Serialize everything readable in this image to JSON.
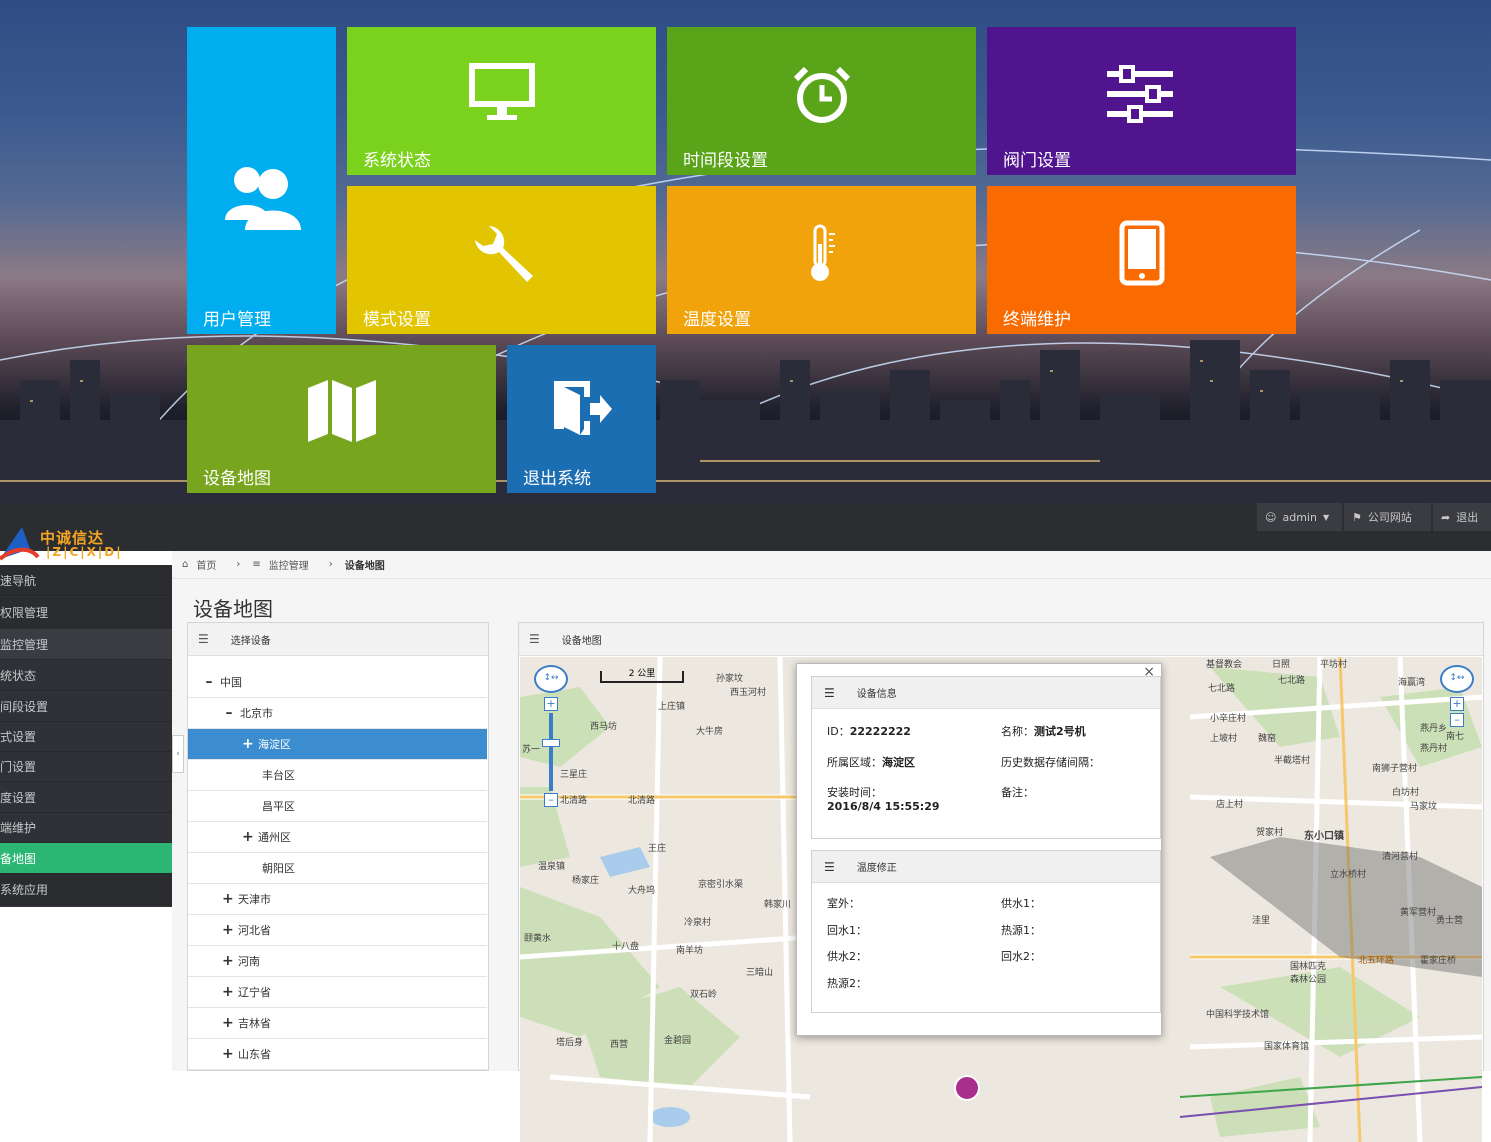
{
  "tiles": {
    "user": {
      "label": "用户管理",
      "color": "#00adef"
    },
    "status": {
      "label": "系统状态",
      "color": "#7bd21d"
    },
    "time": {
      "label": "时间段设置",
      "color": "#5aa41a"
    },
    "valve": {
      "label": "阀门设置",
      "color": "#51148f"
    },
    "mode": {
      "label": "模式设置",
      "color": "#e2c500"
    },
    "temp": {
      "label": "温度设置",
      "color": "#f0a30a"
    },
    "terminal": {
      "label": "终端维护",
      "color": "#f96a00"
    },
    "map": {
      "label": "设备地图",
      "color": "#78a51e"
    },
    "logout": {
      "label": "退出系统",
      "color": "#1b6eb2"
    }
  },
  "logo": {
    "cn": "中诚信达",
    "en": "|Z|C|X|D|"
  },
  "topbar": {
    "user": "admin",
    "site": "公司网站",
    "exit": "退出"
  },
  "sidebar": [
    "速导航",
    "权限管理",
    "监控管理",
    "统状态",
    "间段设置",
    "式设置",
    "门设置",
    "度设置",
    "端维护",
    "备地图",
    "系统应用"
  ],
  "breadcrumb": {
    "home": "首页",
    "section": "监控管理",
    "current": "设备地图"
  },
  "page_title": "设备地图",
  "tree": {
    "header": "选择设备",
    "rows": [
      "中国",
      "北京市",
      "海淀区",
      "丰台区",
      "昌平区",
      "通州区",
      "朝阳区",
      "天津市",
      "河北省",
      "河南",
      "辽宁省",
      "吉林省",
      "山东省"
    ]
  },
  "mappanel": {
    "header": "设备地图",
    "scale": "2 公里",
    "labels": [
      "上庄镇",
      "西马坊",
      "大牛房",
      "苏一",
      "三星庄",
      "北清路",
      "北清路",
      "王庄",
      "温泉镇",
      "杨家庄",
      "大舟坞",
      "京密引水渠",
      "韩家川",
      "冷泉村",
      "颐黄水",
      "十八盘",
      "南羊坊",
      "三暗山",
      "双石岭",
      "塔后身",
      "西营",
      "金碧园",
      "孙家坟",
      "西玉河村",
      "七北路",
      "七北路",
      "小辛庄村",
      "上坡村",
      "魏窑",
      "平坊村",
      "半截塔村",
      "燕丹乡",
      "燕丹村",
      "南狮子营村",
      "白坊村",
      "马家坟",
      "店上村",
      "贺家村",
      "东小口镇",
      "清河营村",
      "立水桥村",
      "黄军营村",
      "勇士营",
      "北五环路",
      "洼里",
      "霍家庄桥",
      "国林匹克森林公园",
      "中国科学技术馆",
      "国家体育馆",
      "基督教会",
      "日照",
      "海赢湾",
      "南七"
    ]
  },
  "popup": {
    "info_header": "设备信息",
    "id_label": "ID：",
    "id_value": "22222222",
    "name_label": "名称：",
    "name_value": "测试2号机",
    "area_label": "所属区域：",
    "area_value": "海淀区",
    "history_label": "历史数据存储间隔：",
    "install_label": "安装时间：",
    "install_value": "2016/8/4 15:55:29",
    "note_label": "备注：",
    "temp_header": "温度修正",
    "outdoor": "室外：",
    "supply1": "供水1：",
    "return1": "回水1：",
    "heat1": "热源1：",
    "supply2": "供水2：",
    "return2": "回水2：",
    "heat2": "热源2：",
    "close": "×"
  }
}
